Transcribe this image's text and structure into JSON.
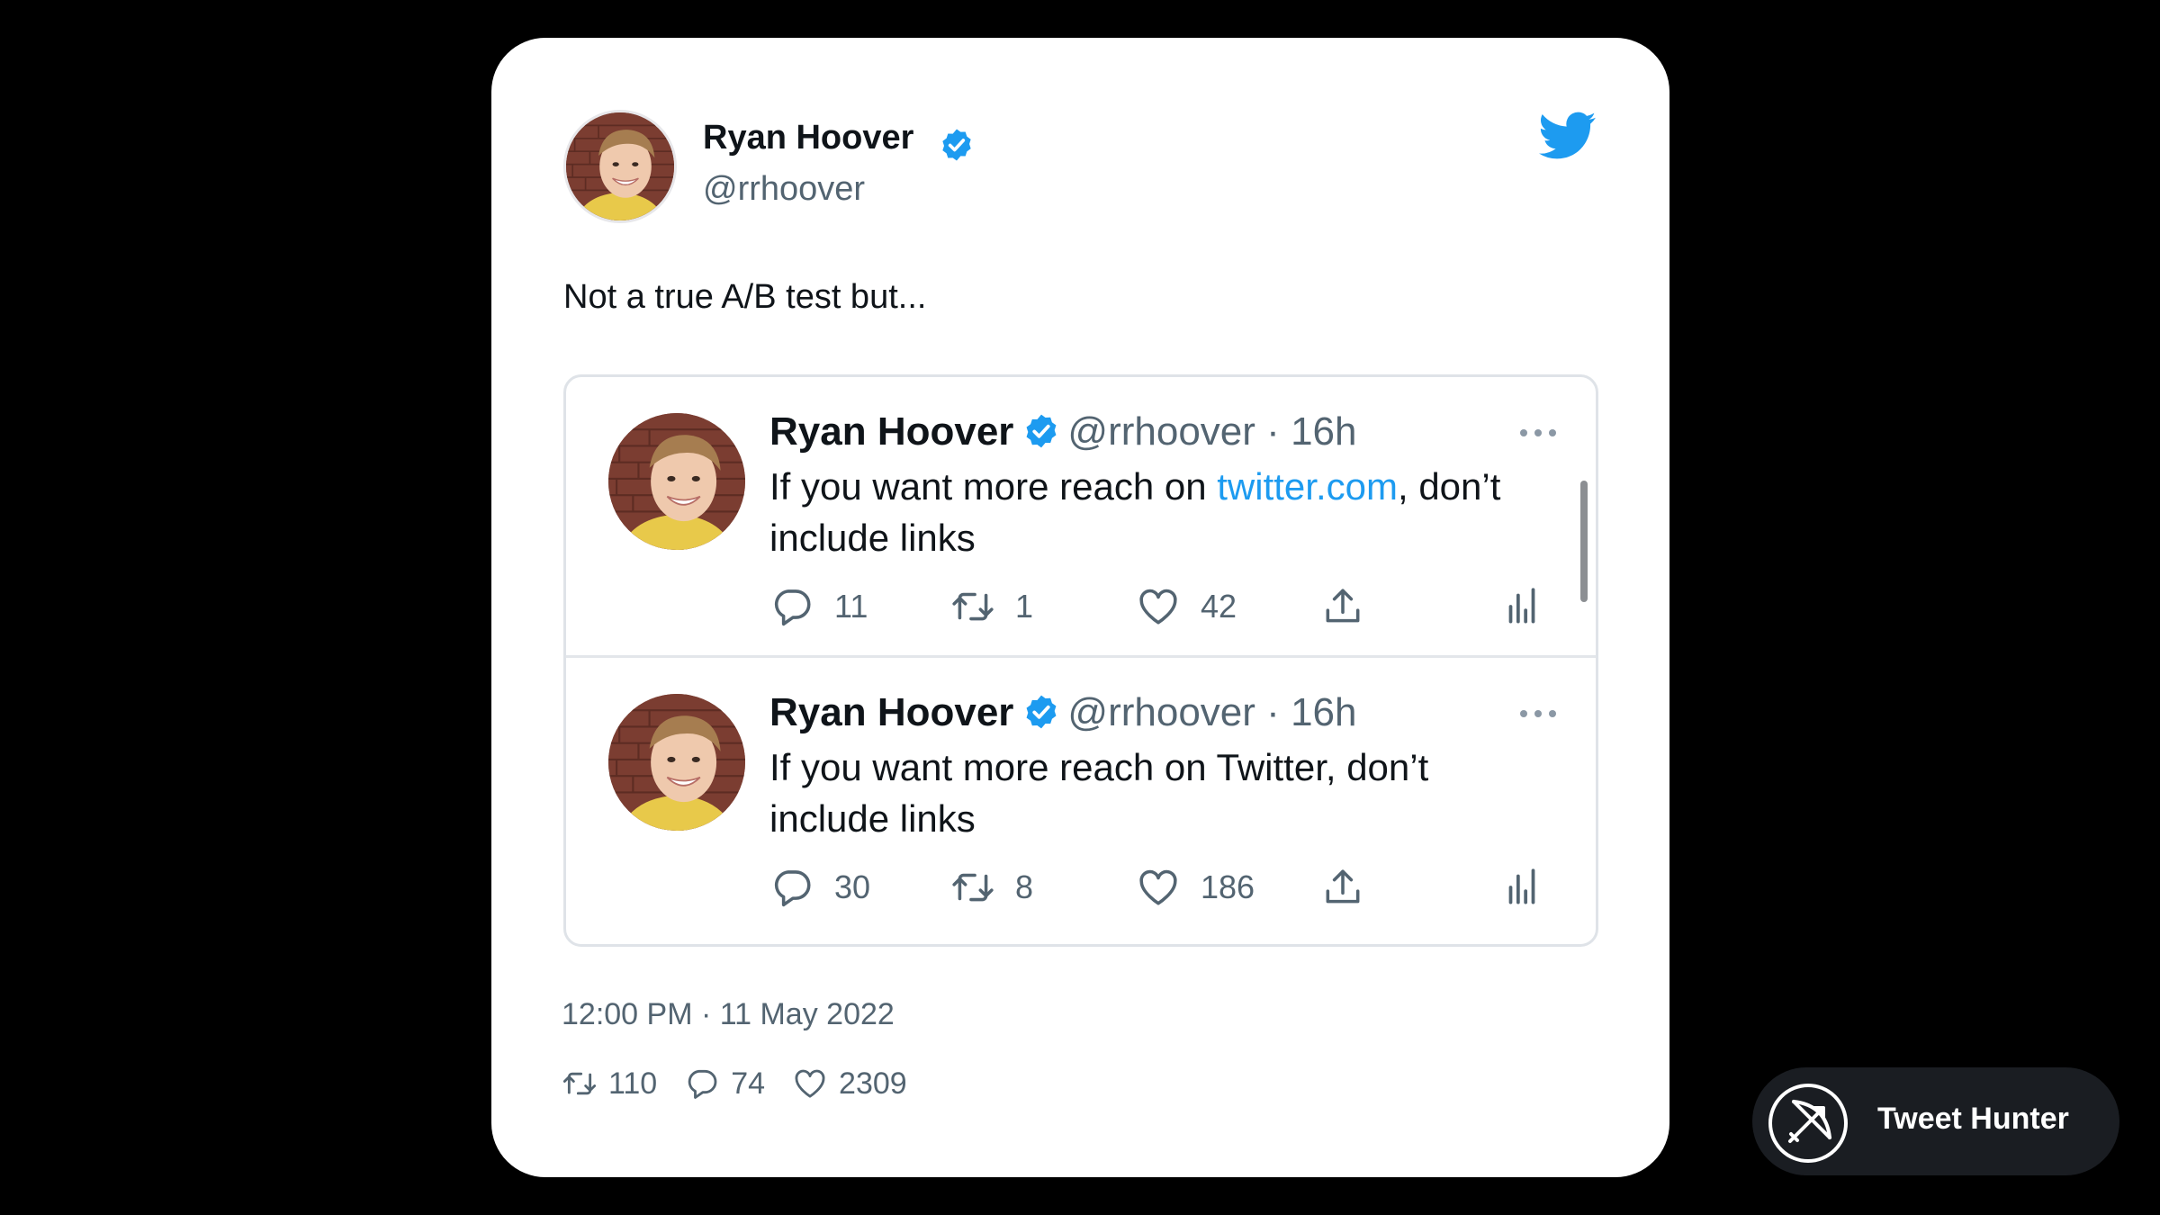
{
  "tweet": {
    "author": {
      "name": "Ryan Hoover",
      "handle": "@rrhoover",
      "verified": true
    },
    "text": "Not a true A/B test but...",
    "timestamp": "12:00 PM · 11 May 2022",
    "stats": {
      "retweets": "110",
      "replies": "74",
      "likes": "2309"
    },
    "icons": {
      "brand": "twitter-bird-icon",
      "verified": "verified-badge-icon",
      "retweet": "retweet-icon",
      "reply": "reply-icon",
      "like": "heart-icon"
    }
  },
  "embedded_tweets": [
    {
      "name": "Ryan Hoover",
      "handle": "@rrhoover",
      "separator": "·",
      "time": "16h",
      "text_before": "If you want more reach on ",
      "link": "twitter.com",
      "text_after": ", don’t include links",
      "replies": "11",
      "retweets": "1",
      "likes": "42"
    },
    {
      "name": "Ryan Hoover",
      "handle": "@rrhoover",
      "separator": "·",
      "time": "16h",
      "text_before": "If you want more reach on Twitter, don’t include links",
      "link": "",
      "text_after": "",
      "replies": "30",
      "retweets": "8",
      "likes": "186"
    }
  ],
  "branding": {
    "label": "Tweet Hunter",
    "icon": "bow-and-arrow-icon"
  },
  "colors": {
    "background": "#000000",
    "card": "#ffffff",
    "twitter_blue": "#1d9bf0",
    "text_primary": "#0f1419",
    "text_secondary": "#536471",
    "badge_background": "#1a1d22"
  }
}
